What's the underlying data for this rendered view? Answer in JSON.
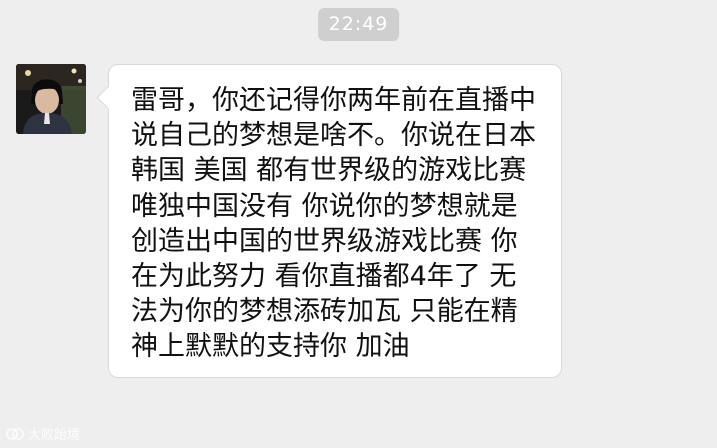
{
  "chat": {
    "timestamp": "22:49",
    "message": {
      "avatar_icon": "user-avatar-photo",
      "lines": [
        "雷哥，你还记得你两年前在直播中",
        "说自己的梦想是啥不。你说在日本",
        " 韩国 美国 都有世界级的游戏比赛",
        " 唯独中国没有 你说你的梦想就是",
        "创造出中国的世界级游戏比赛 你",
        "在为此努力 看你直播都4年了 无",
        "法为你的梦想添砖加瓦 只能在精",
        "神上默默的支持你 加油"
      ]
    }
  },
  "watermark": {
    "text": "大败跆境",
    "icon": "watermark-logo-icon"
  },
  "colors": {
    "background": "#eeeeee",
    "bubble": "#ffffff",
    "timestamp_bg": "#cfcfcf",
    "text": "#111111"
  }
}
